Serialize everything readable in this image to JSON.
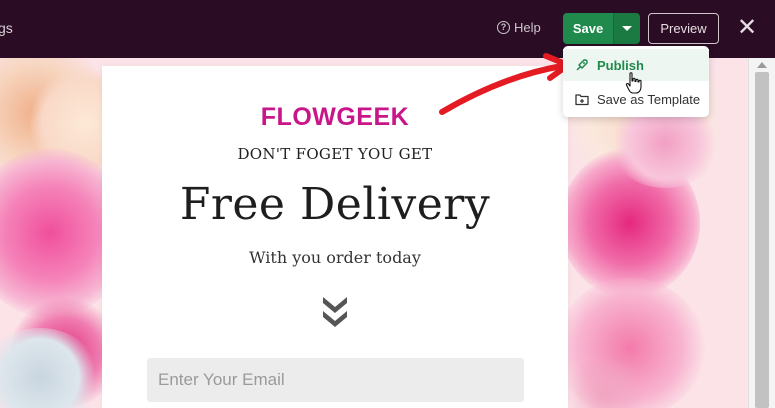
{
  "topbar": {
    "left_fragment": "gs",
    "help_label": "Help",
    "save_label": "Save",
    "preview_label": "Preview"
  },
  "dropdown": {
    "items": [
      {
        "label": "Publish",
        "icon": "rocket-icon"
      },
      {
        "label": "Save as Template",
        "icon": "folder-icon"
      }
    ]
  },
  "popup": {
    "brand": "FLOWGEEK",
    "kicker": "DON'T FOGET YOU GET",
    "headline": "Free Delivery",
    "subline": "With you order today",
    "email_placeholder": "Enter Your Email"
  },
  "colors": {
    "topbar": "#2a0d24",
    "save_green": "#1f8a4c",
    "brand_magenta": "#c8168a",
    "arrow_red": "#e41b23",
    "background_pink": "#fbe3e8"
  }
}
